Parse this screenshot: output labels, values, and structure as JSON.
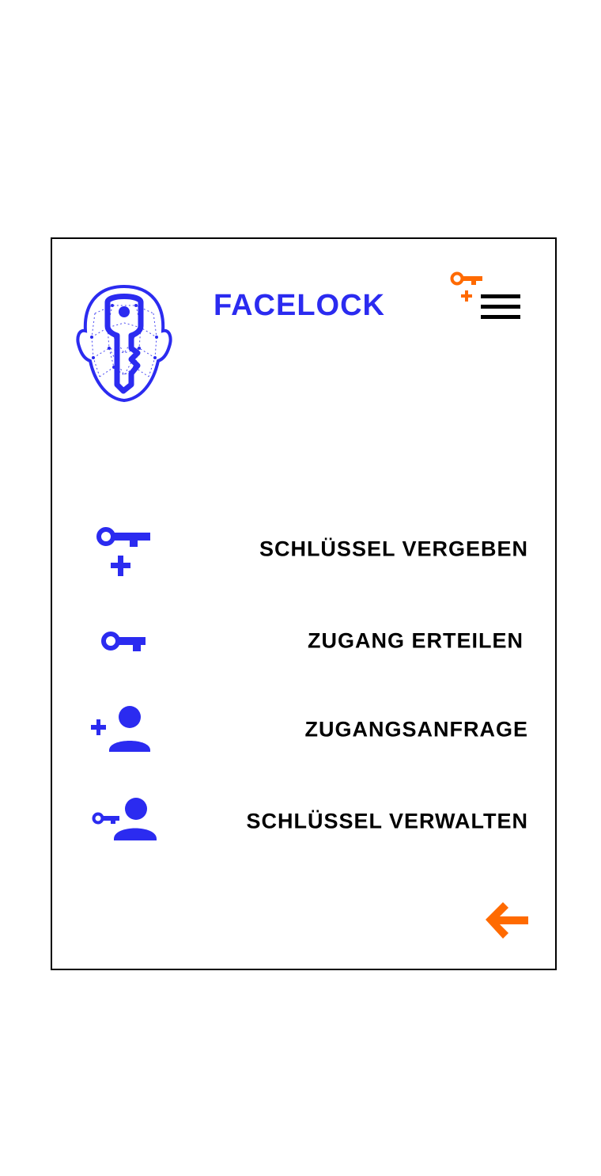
{
  "app": {
    "title": "FACELOCK"
  },
  "colors": {
    "brand_blue": "#2b2bf0",
    "accent_orange": "#ff6a00",
    "text": "#000000"
  },
  "header": {
    "logo_icon": "face-key-logo-icon",
    "menu_icon": "key-plus-hamburger-menu-icon"
  },
  "menu": {
    "items": [
      {
        "label": "SCHLÜSSEL VERGEBEN",
        "icon": "key-plus-icon"
      },
      {
        "label": "ZUGANG ERTEILEN",
        "icon": "key-icon"
      },
      {
        "label": "ZUGANGSANFRAGE",
        "icon": "add-person-icon"
      },
      {
        "label": "SCHLÜSSEL VERWALTEN",
        "icon": "key-person-icon"
      }
    ]
  },
  "footer": {
    "back_icon": "arrow-left-icon"
  }
}
